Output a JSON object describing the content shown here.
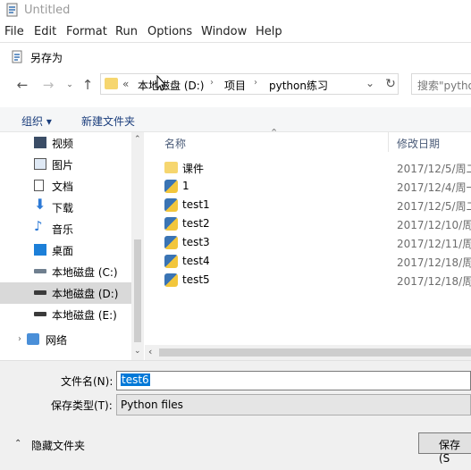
{
  "window": {
    "title": "Untitled"
  },
  "menu": [
    "File",
    "Edit",
    "Format",
    "Run",
    "Options",
    "Window",
    "Help"
  ],
  "dialog": {
    "title": "另存为",
    "address": {
      "overflow": "«",
      "crumbs": [
        "本地磁盘 (D:)",
        "项目",
        "python练习"
      ]
    },
    "search_placeholder": "搜索\"pytho",
    "toolbar": {
      "organize": "组织 ▾",
      "new_folder": "新建文件夹"
    },
    "sidebar": [
      {
        "label": "视频",
        "icon": "video-icon"
      },
      {
        "label": "图片",
        "icon": "picture-icon"
      },
      {
        "label": "文档",
        "icon": "document-icon"
      },
      {
        "label": "下载",
        "icon": "download-icon"
      },
      {
        "label": "音乐",
        "icon": "music-icon"
      },
      {
        "label": "桌面",
        "icon": "desktop-icon"
      },
      {
        "label": "本地磁盘 (C:)",
        "icon": "drive-icon"
      },
      {
        "label": "本地磁盘 (D:)",
        "icon": "drive-icon",
        "selected": true
      },
      {
        "label": "本地磁盘 (E:)",
        "icon": "drive-icon"
      },
      {
        "label": "网络",
        "icon": "network-icon"
      }
    ],
    "columns": {
      "name": "名称",
      "date": "修改日期"
    },
    "files": [
      {
        "name": "课件",
        "date": "2017/12/5/周二",
        "type": "folder"
      },
      {
        "name": "1",
        "date": "2017/12/4/周一",
        "type": "python"
      },
      {
        "name": "test1",
        "date": "2017/12/5/周二",
        "type": "python"
      },
      {
        "name": "test2",
        "date": "2017/12/10/周",
        "type": "python"
      },
      {
        "name": "test3",
        "date": "2017/12/11/周",
        "type": "python"
      },
      {
        "name": "test4",
        "date": "2017/12/18/周",
        "type": "python"
      },
      {
        "name": "test5",
        "date": "2017/12/18/周",
        "type": "python"
      }
    ],
    "filename_label": "文件名(N):",
    "filename_value": "test6",
    "filetype_label": "保存类型(T):",
    "filetype_value": "Python files",
    "hide_folders": "隐藏文件夹",
    "save_button": "保存(S"
  }
}
